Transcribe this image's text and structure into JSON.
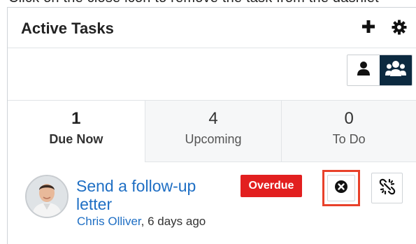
{
  "caption_fragment": "Click on the close icon to remove the task from the dashlet",
  "header": {
    "title": "Active Tasks",
    "add_icon": "plus-icon",
    "settings_icon": "gear-icon"
  },
  "filters": {
    "my_items_icon": "user-icon",
    "team_items_icon": "users-icon",
    "active": "team"
  },
  "tabs": [
    {
      "count": "1",
      "label": "Due Now",
      "active": true
    },
    {
      "count": "4",
      "label": "Upcoming",
      "active": false
    },
    {
      "count": "0",
      "label": "To Do",
      "active": false
    }
  ],
  "task": {
    "title": "Send a follow-up letter",
    "author": "Chris Olliver",
    "time": ", 6 days ago",
    "badge": "Overdue",
    "close_icon": "close-circle-icon",
    "unlink_icon": "unlink-icon"
  },
  "colors": {
    "link": "#1f6fc4",
    "badge": "#e21f1f",
    "highlight": "#e8412a",
    "active_toggle": "#0c2a40"
  }
}
